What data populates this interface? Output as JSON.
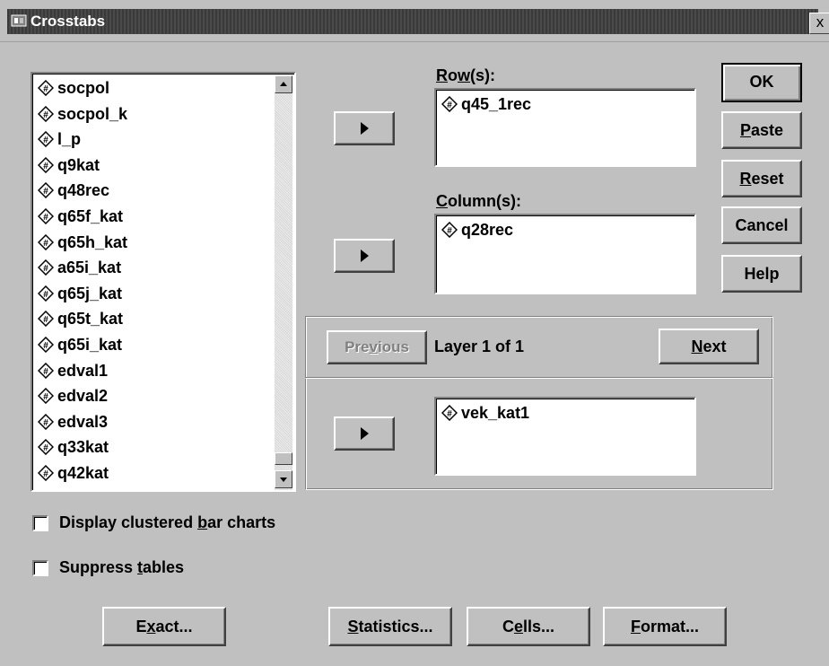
{
  "window": {
    "title": "Crosstabs",
    "close_label": "x"
  },
  "source_list": {
    "items": [
      "socpol",
      "socpol_k",
      "l_p",
      "q9kat",
      "q48rec",
      "q65f_kat",
      "q65h_kat",
      "a65i_kat",
      "q65j_kat",
      "q65t_kat",
      "q65i_kat",
      "edval1",
      "edval2",
      "edval3",
      "q33kat",
      "q42kat"
    ]
  },
  "rows": {
    "label": "Row(s):",
    "items": [
      "q45_1rec"
    ]
  },
  "columns": {
    "label": "Column(s):",
    "items": [
      "q28rec"
    ]
  },
  "layer": {
    "previous_label": "Previous",
    "status": "Layer 1 of 1",
    "next_label": "Next",
    "items": [
      "vek_kat1"
    ]
  },
  "side_buttons": {
    "ok": "OK",
    "paste": "Paste",
    "reset": "Reset",
    "cancel": "Cancel",
    "help": "Help"
  },
  "options": {
    "clustered_bar": {
      "label": "Display clustered bar charts",
      "checked": false
    },
    "suppress_tables": {
      "label": "Suppress tables",
      "checked": false
    }
  },
  "bottom_buttons": {
    "exact": "Exact...",
    "statistics": "Statistics...",
    "cells": "Cells...",
    "format": "Format..."
  },
  "icons": {
    "variable": "numeric-variable-icon",
    "move": "right-arrow-icon"
  }
}
